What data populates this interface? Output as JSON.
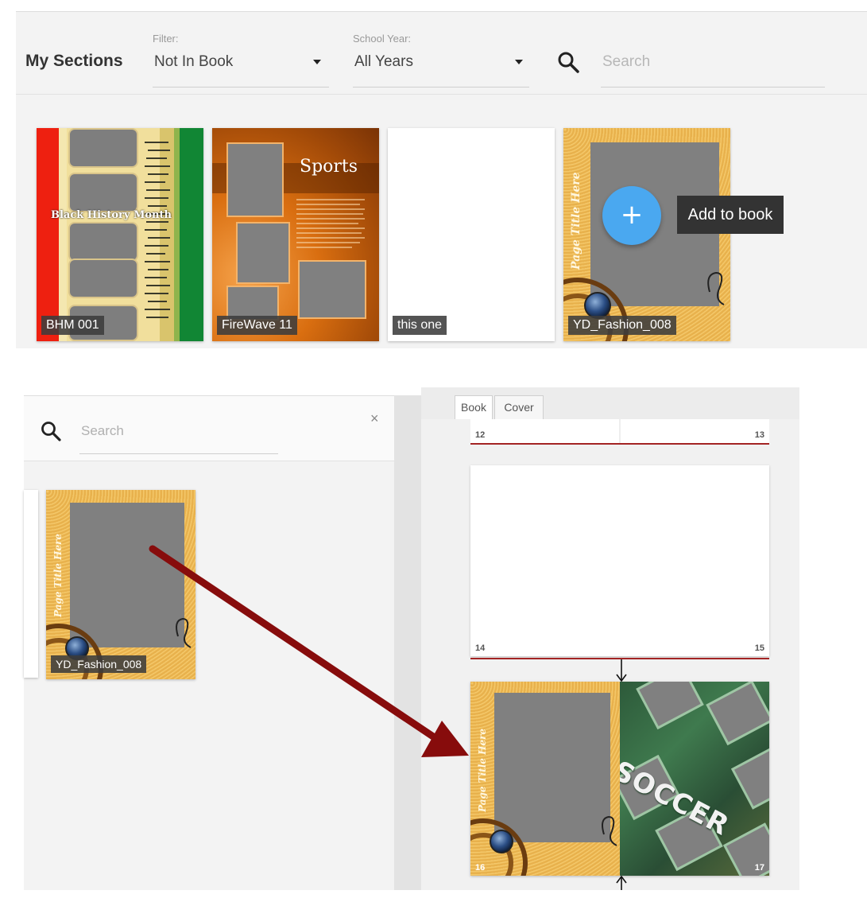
{
  "header": {
    "title": "My Sections",
    "filter": {
      "label": "Filter:",
      "value": "Not In Book"
    },
    "school_year": {
      "label": "School Year:",
      "value": "All Years"
    },
    "search": {
      "placeholder": "Search"
    }
  },
  "sections": [
    {
      "label": "BHM 001",
      "heading": "Black History Month",
      "icon": "theme-thumbnail"
    },
    {
      "label": "FireWave 11",
      "heading": "Sports",
      "icon": "theme-thumbnail"
    },
    {
      "label": "this one",
      "icon": "theme-thumbnail"
    },
    {
      "label": "YD_Fashion_008",
      "heading": "Page Title Here",
      "icon": "theme-thumbnail"
    }
  ],
  "add_button": {
    "symbol": "+",
    "tooltip": "Add to book",
    "color": "#4aa8f0"
  },
  "side_panel": {
    "search": {
      "placeholder": "Search"
    },
    "close_symbol": "×",
    "item": {
      "label": "YD_Fashion_008",
      "heading": "Page Title Here"
    }
  },
  "book": {
    "tabs": [
      "Book",
      "Cover"
    ],
    "spreads": [
      {
        "left_page": "12",
        "right_page": "13"
      },
      {
        "left_page": "14",
        "right_page": "15"
      },
      {
        "left_page": "16",
        "right_page": "17",
        "left_heading": "Page Title Here",
        "right_heading": "SOCCER"
      }
    ],
    "arrow_color": "#8b0b0b",
    "spread_line_color": "#a32424"
  }
}
